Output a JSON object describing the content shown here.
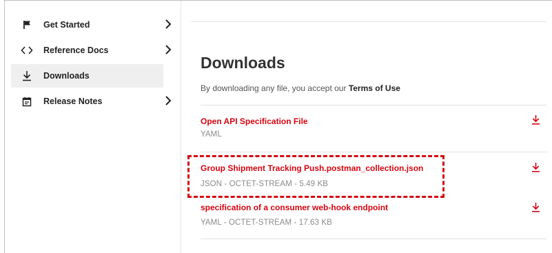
{
  "sidebar": {
    "items": [
      {
        "label": "Get Started",
        "icon": "flag-icon",
        "has_chevron": true,
        "active": false
      },
      {
        "label": "Reference Docs",
        "icon": "code-icon",
        "has_chevron": true,
        "active": false
      },
      {
        "label": "Downloads",
        "icon": "download-icon",
        "has_chevron": false,
        "active": true
      },
      {
        "label": "Release Notes",
        "icon": "calendar-icon",
        "has_chevron": true,
        "active": false
      }
    ]
  },
  "main": {
    "title": "Downloads",
    "intro_text": "By downloading any file, you accept our ",
    "terms_link": "Terms of Use",
    "downloads": [
      {
        "title": "Open API Specification File",
        "meta": "YAML"
      },
      {
        "title": "Group Shipment Tracking Push.postman_collection.json",
        "meta": "JSON - OCTET-STREAM - 5.49 KB",
        "highlighted": true
      },
      {
        "title": "specification of a consumer web-hook endpoint",
        "meta": "YAML - OCTET-STREAM - 17.63 KB"
      }
    ]
  },
  "colors": {
    "accent": "#d40511",
    "active_bg": "#efefef",
    "text": "#333333",
    "muted": "#8a8a8a"
  }
}
